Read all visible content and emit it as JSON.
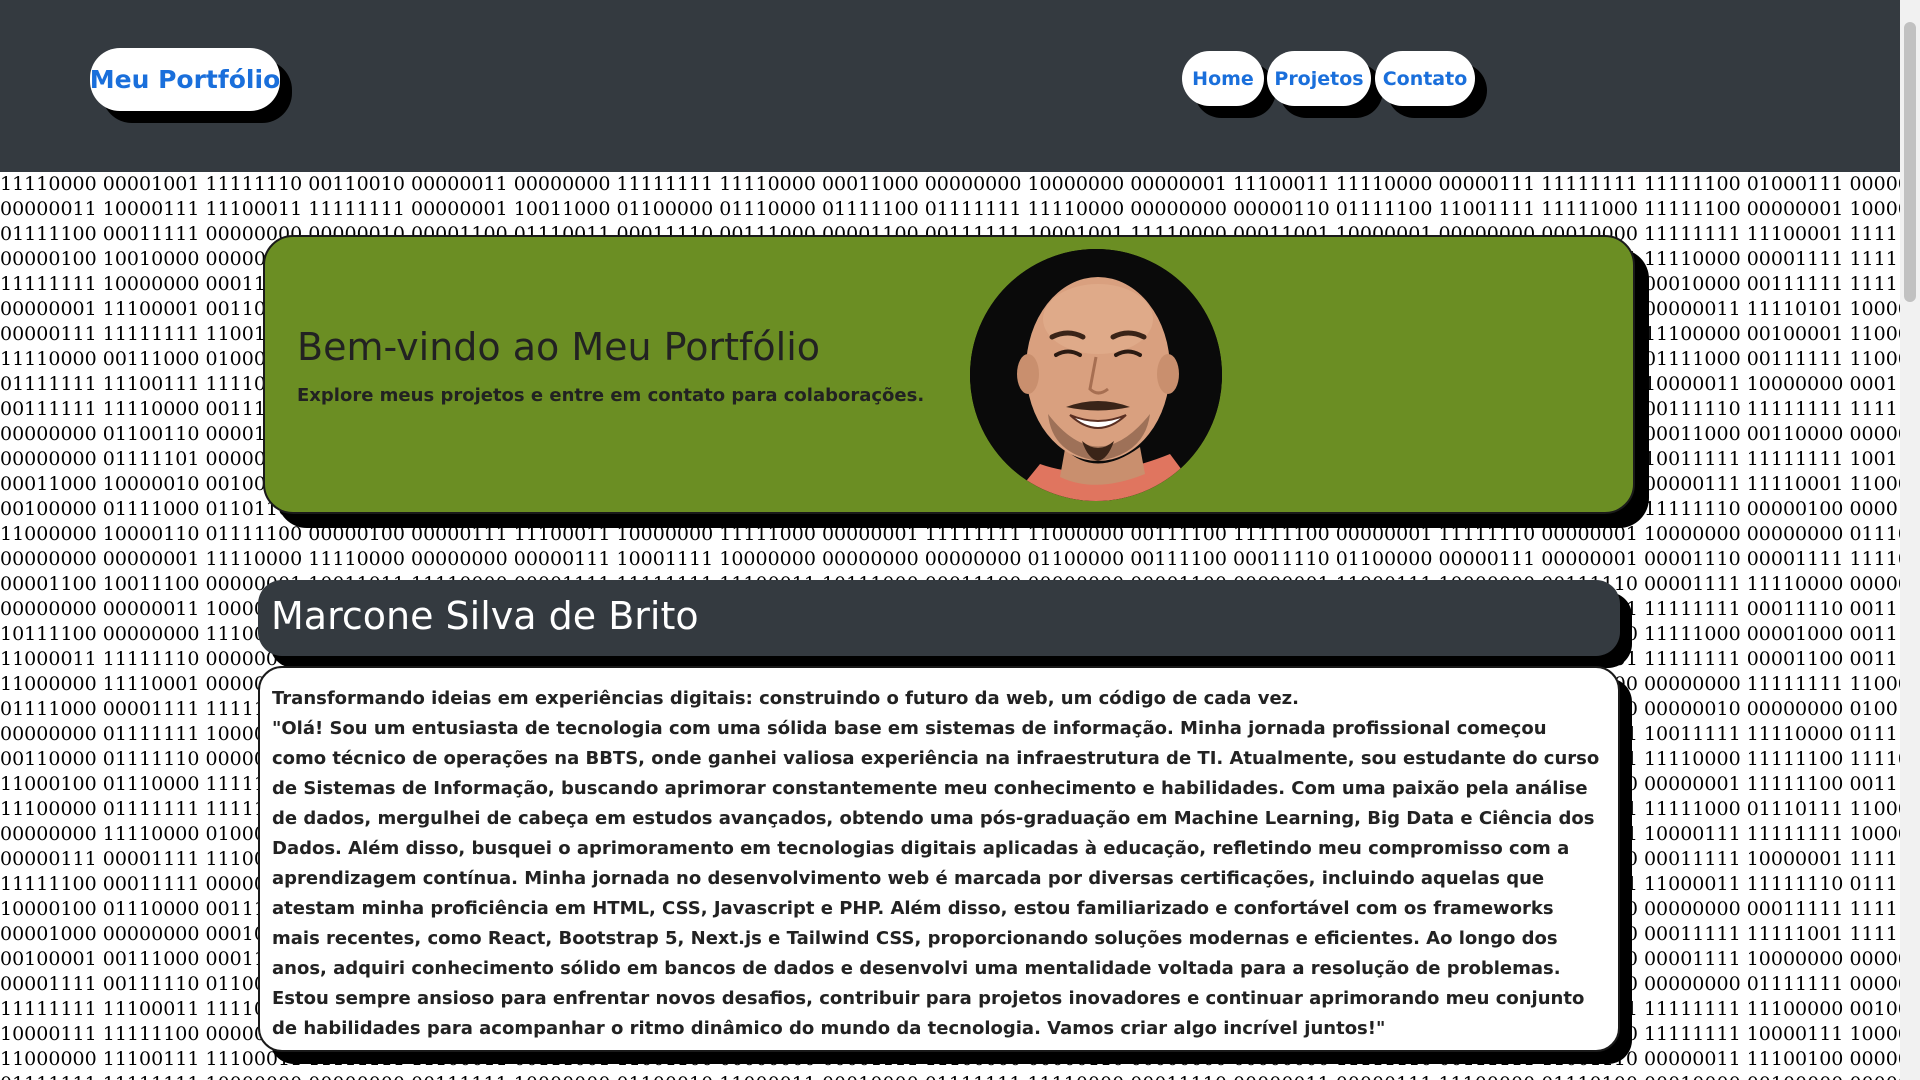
{
  "header": {
    "brand": "Meu Portfólio",
    "nav": [
      "Home",
      "Projetos",
      "Contato"
    ]
  },
  "hero": {
    "title": "Bem-vindo ao Meu Portfólio",
    "subtitle": "Explore meus projetos e entre em contato para colaborações."
  },
  "profile": {
    "name": "Marcone Silva de Brito",
    "tagline": "Transformando ideias em experiências digitais: construindo o futuro da web, um código de cada vez.",
    "bio": "\"Olá! Sou um entusiasta de tecnologia com uma sólida base em sistemas de informação. Minha jornada profissional começou como técnico de operações na BBTS, onde ganhei valiosa experiência na infraestrutura de TI. Atualmente, sou estudante do curso de Sistemas de Informação, buscando aprimorar constantemente meu conhecimento e habilidades. Com uma paixão pela análise de dados, mergulhei de cabeça em estudos avançados, obtendo uma pós-graduação em Machine Learning, Big Data e Ciência dos Dados. Além disso, busquei o aprimoramento em tecnologias digitais aplicadas à educação, refletindo meu compromisso com a aprendizagem contínua. Minha jornada no desenvolvimento web é marcada por diversas certificações, incluindo aquelas que atestam minha proficiência em HTML, CSS, Javascript e PHP. Além disso, estou familiarizado e confortável com os frameworks mais recentes, como React, Bootstrap 5, Next.js e Tailwind CSS, proporcionando soluções modernas e eficientes. Ao longo dos anos, adquiri conhecimento sólido em bancos de dados e desenvolvi uma mentalidade voltada para a resolução de problemas. Estou sempre ansioso para enfrentar novos desafios, contribuir para projetos inovadores e continuar aprimorando meu conjunto de habilidades para acompanhar o ritmo dinâmico do mundo da tecnologia. Vamos criar algo incrível juntos!\""
  },
  "colors": {
    "header_bg": "#343a40",
    "hero_bg": "#6b8e23",
    "link": "#1a6fdb"
  }
}
